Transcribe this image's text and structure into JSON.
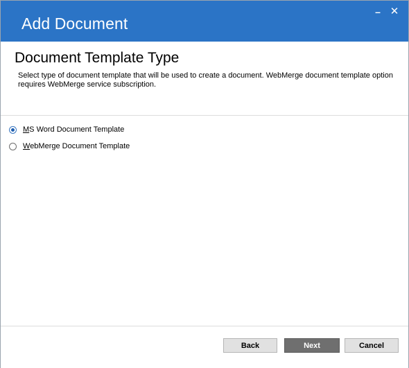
{
  "window": {
    "title": "Add Document",
    "minimize_glyph": "–",
    "close_glyph": "✕"
  },
  "header": {
    "title": "Document Template Type",
    "description": "Select type of document template that will be used to create a document. WebMerge document template option requires WebMerge service subscription."
  },
  "options": [
    {
      "label_prefix": "M",
      "label_rest": "S Word Document Template",
      "selected": true
    },
    {
      "label_prefix": "W",
      "label_rest": "ebMerge Document Template",
      "selected": false
    }
  ],
  "footer": {
    "back_label": "Back",
    "next_label": "Next",
    "cancel_label": "Cancel"
  },
  "colors": {
    "titlebar": "#2b74c6",
    "next_button": "#6f6f6f",
    "radio_selected": "#1f5fb0"
  }
}
